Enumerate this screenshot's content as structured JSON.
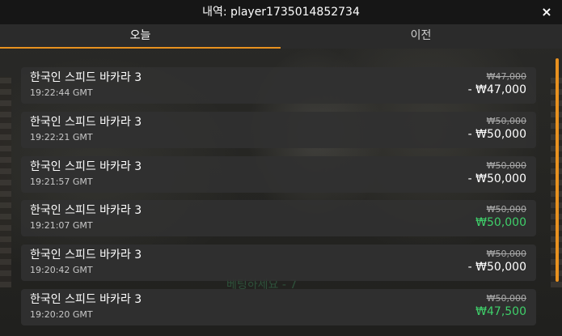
{
  "header": {
    "title": "내역: player1735014852734",
    "close_label": "×"
  },
  "tabs": [
    {
      "label": "오늘",
      "active": true
    },
    {
      "label": "이전",
      "active": false
    }
  ],
  "background_text": "베팅하세요 - 7",
  "rows": [
    {
      "game": "한국인 스피드 바카라 3",
      "time": "19:22:44 GMT",
      "bet": "₩47,000",
      "result": "- ₩47,000",
      "outcome": "loss"
    },
    {
      "game": "한국인 스피드 바카라 3",
      "time": "19:22:21 GMT",
      "bet": "₩50,000",
      "result": "- ₩50,000",
      "outcome": "loss"
    },
    {
      "game": "한국인 스피드 바카라 3",
      "time": "19:21:57 GMT",
      "bet": "₩50,000",
      "result": "- ₩50,000",
      "outcome": "loss"
    },
    {
      "game": "한국인 스피드 바카라 3",
      "time": "19:21:07 GMT",
      "bet": "₩50,000",
      "result": "₩50,000",
      "outcome": "win"
    },
    {
      "game": "한국인 스피드 바카라 3",
      "time": "19:20:42 GMT",
      "bet": "₩50,000",
      "result": "- ₩50,000",
      "outcome": "loss"
    },
    {
      "game": "한국인 스피드 바카라 3",
      "time": "19:20:20 GMT",
      "bet": "₩50,000",
      "result": "₩47,500",
      "outcome": "win"
    }
  ],
  "colors": {
    "accent": "#e8911f",
    "win": "#3fcf6a",
    "loss": "#ffffff"
  }
}
